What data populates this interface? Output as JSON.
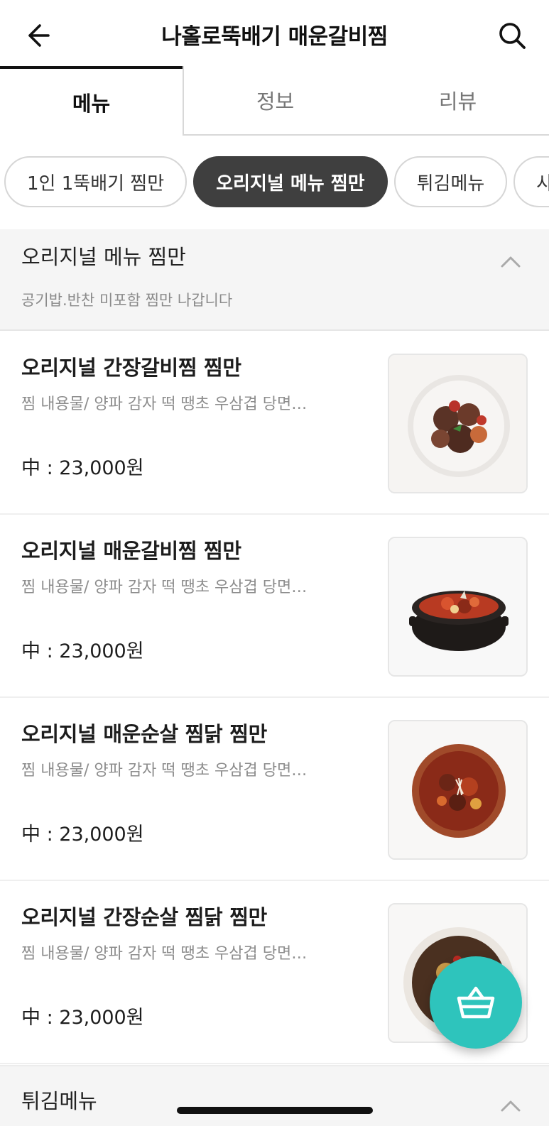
{
  "header": {
    "title": "나홀로뚝배기 매운갈비찜",
    "back_icon": "arrow-left-icon",
    "search_icon": "search-icon"
  },
  "tabs": [
    {
      "label": "메뉴",
      "active": true
    },
    {
      "label": "정보",
      "active": false
    },
    {
      "label": "리뷰",
      "active": false
    }
  ],
  "categories": [
    {
      "label": "1인 1뚝배기 찜만",
      "selected": false
    },
    {
      "label": "오리지널 메뉴 찜만",
      "selected": true
    },
    {
      "label": "튀김메뉴",
      "selected": false
    },
    {
      "label": "사이드",
      "selected": false
    }
  ],
  "section": {
    "title": "오리지널 메뉴 찜만",
    "subtitle": "공기밥.반찬 미포함 찜만 나갑니다"
  },
  "menu_items": [
    {
      "name": "오리지널 간장갈비찜 찜만",
      "description": "찜 내용물/ 양파 감자 떡 땡초 우삼겹 당면…",
      "price": "中 : 23,000원"
    },
    {
      "name": "오리지널 매운갈비찜 찜만",
      "description": "찜 내용물/ 양파 감자 떡 땡초 우삼겹 당면…",
      "price": "中 : 23,000원"
    },
    {
      "name": "오리지널 매운순살 찜닭 찜만",
      "description": "찜 내용물/ 양파 감자 떡 땡초 우삼겹 당면…",
      "price": "中 : 23,000원"
    },
    {
      "name": "오리지널 간장순살 찜닭 찜만",
      "description": "찜 내용물/ 양파 감자 떡 땡초 우삼겹 당면…",
      "price": "中 : 23,000원"
    }
  ],
  "section2": {
    "title": "튀김메뉴"
  },
  "cart_icon": "basket-icon",
  "colors": {
    "accent": "#2ec4bc",
    "chip_selected": "#3f3f3f",
    "section_bg": "#f5f5f5"
  }
}
